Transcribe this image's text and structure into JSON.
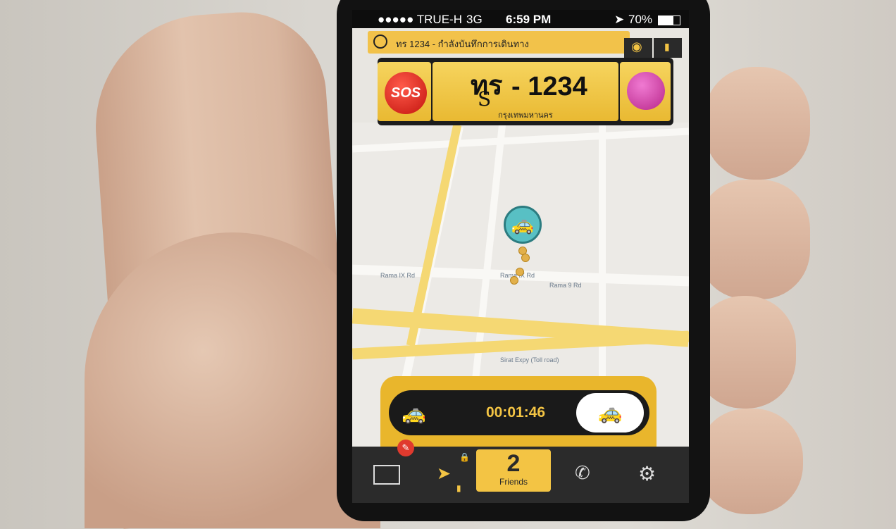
{
  "status_bar": {
    "carrier": "●●●●● TRUE-H",
    "network": "3G",
    "time": "6:59 PM",
    "battery": "70%"
  },
  "banner": {
    "text": "ทร 1234 - กำลังบันทึกการเดินทาง"
  },
  "plate": {
    "sos_label": "SOS",
    "char_top": "ทร",
    "char_sub": "S",
    "number": "- 1234",
    "province": "กรุงเทพมหานคร"
  },
  "map": {
    "labels": [
      "Rama IX Rd",
      "Rama 9 Rd",
      "Sirat Expy (Toll road)",
      "Rama IX Rd"
    ]
  },
  "trip": {
    "timer": "00:01:46"
  },
  "tabbar": {
    "friends_count": "2",
    "friends_label": "Friends"
  },
  "colors": {
    "accent": "#f3c444",
    "sos": "#d8231b",
    "pin": "#58c0c4"
  },
  "icons": [
    "id-card-icon",
    "edit-icon",
    "location-arrow-icon",
    "lock-icon",
    "signal-icon",
    "phone-icon",
    "gear-icon",
    "eye-icon",
    "taxi-icon",
    "passenger-icon"
  ]
}
